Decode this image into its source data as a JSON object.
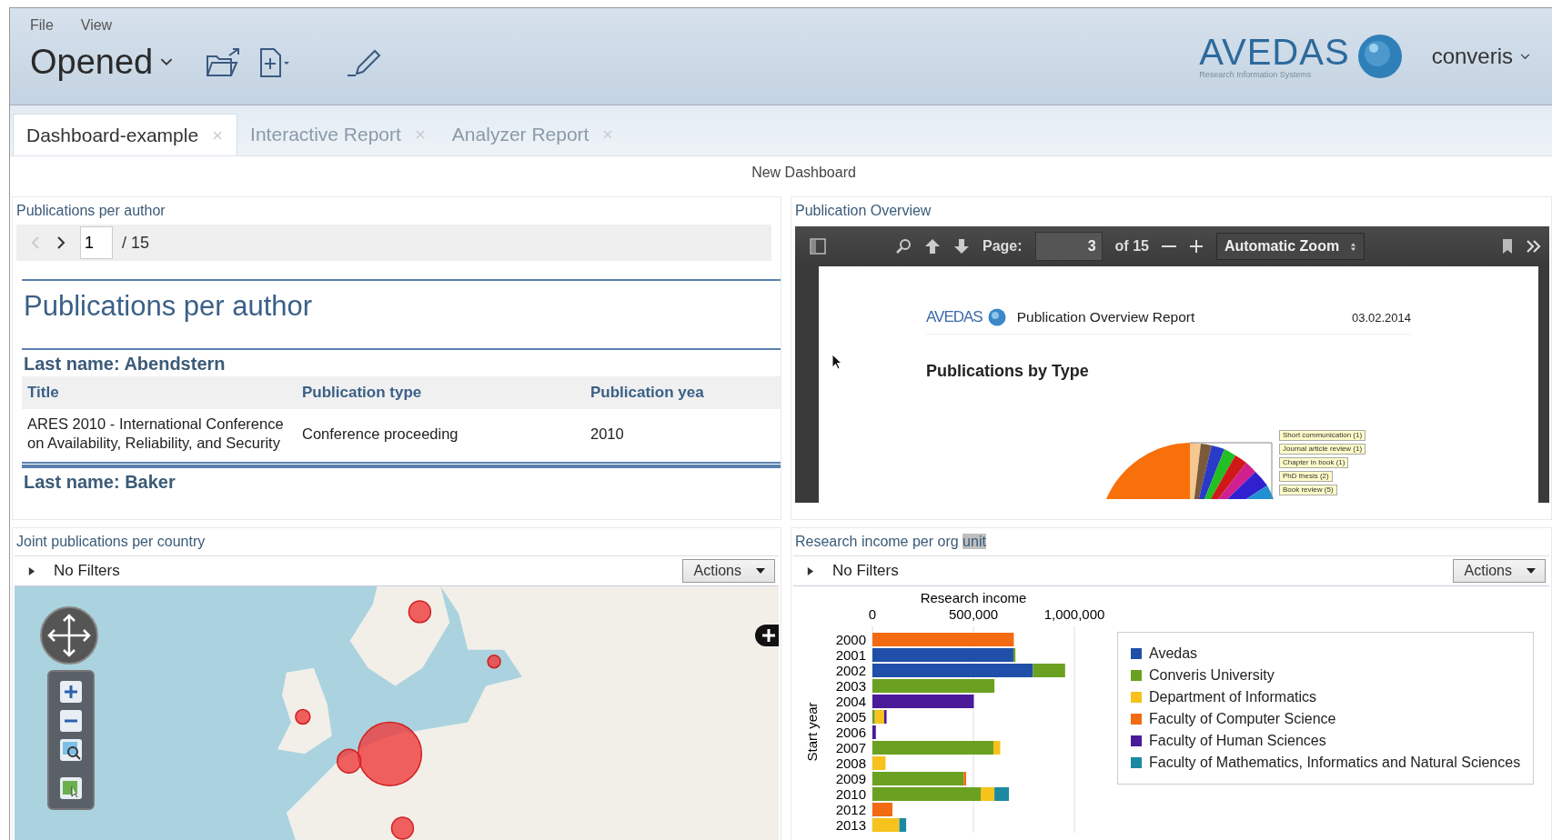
{
  "menu": [
    {
      "label": "File"
    },
    {
      "label": "View"
    }
  ],
  "header": {
    "view_selector": "Opened",
    "logo": {
      "name": "AVEDAS",
      "tagline": "Research Information Systems"
    },
    "user_menu": "converis"
  },
  "tabs": [
    {
      "label": "Dashboard-example",
      "selected": true
    },
    {
      "label": "Interactive Report",
      "selected": false
    },
    {
      "label": "Analyzer Report",
      "selected": false
    }
  ],
  "dashboard_title": "New Dashboard",
  "author_panel": {
    "title": "Publications per author",
    "pager": {
      "page": "1",
      "total": "/ 15",
      "prev_disabled": true
    },
    "report_title": "Publications per author",
    "groups": [
      {
        "heading": "Last name: Abendstern",
        "columns": [
          "Title",
          "Publication type",
          "Publication yea"
        ],
        "rows": [
          [
            "ARES 2010 - International Conference on Availability, Reliability, and Security",
            "Conference proceeding",
            "2010"
          ]
        ]
      },
      {
        "heading": "Last name: Baker"
      }
    ]
  },
  "pdf_panel": {
    "title": "Publication Overview",
    "page_label": "Page:",
    "page": "3",
    "page_count": "of 15",
    "zoom": "Automatic Zoom",
    "document": {
      "logo": "AVEDAS",
      "title": "Publication Overview Report",
      "date": "03.02.2014",
      "heading": "Publications by Type",
      "pie_labels": [
        "Short communication (1)",
        "Journal article review (1)",
        "Chapter in book (1)",
        "PhD thesis (2)",
        "Book review (5)"
      ]
    }
  },
  "map_panel": {
    "title": "Joint publications per country",
    "filter": {
      "label": "No Filters",
      "expanded": false
    },
    "actions": "Actions"
  },
  "income_panel": {
    "title_parts": [
      {
        "text": "Research income per org",
        "selected": false
      },
      {
        "text": "unit",
        "selected": true
      }
    ],
    "filter": {
      "label": "No Filters",
      "expanded": false
    },
    "actions": "Actions",
    "chart_data": {
      "type": "bar",
      "orientation": "horizontal",
      "stacked": true,
      "xlabel": "Research income",
      "ylabel": "Start year",
      "categories": [
        "2000",
        "2001",
        "2002",
        "2003",
        "2004",
        "2005",
        "2006",
        "2007",
        "2008",
        "2009",
        "2010",
        "2012",
        "2013"
      ],
      "xlim": [
        0,
        1000000
      ],
      "legend": true,
      "xticks": [
        {
          "value": 0,
          "label": "0"
        },
        {
          "value": 500000,
          "label": "500,000"
        },
        {
          "value": 1000000,
          "label": "1,000,000"
        }
      ],
      "series": [
        {
          "name": "Avedas",
          "color": "#1f4fa8",
          "values": [
            null,
            698000,
            795000,
            null,
            null,
            null,
            null,
            null,
            null,
            null,
            null,
            null,
            null
          ]
        },
        {
          "name": "Converis University",
          "color": "#6aa121",
          "values": [
            null,
            10000,
            159000,
            604000,
            null,
            12000,
            null,
            599000,
            null,
            452000,
            536000,
            null,
            null
          ]
        },
        {
          "name": "Department of Informatics",
          "color": "#f7c21b",
          "values": [
            null,
            null,
            null,
            null,
            null,
            46000,
            null,
            34000,
            65000,
            null,
            68000,
            null,
            133000
          ]
        },
        {
          "name": "Faculty of Computer Science",
          "color": "#f26b12",
          "values": [
            700000,
            null,
            null,
            null,
            null,
            null,
            null,
            null,
            null,
            12000,
            null,
            99000,
            null
          ]
        },
        {
          "name": "Faculty of Human Sciences",
          "color": "#4a1a9a",
          "values": [
            null,
            null,
            null,
            null,
            502000,
            12000,
            17000,
            null,
            null,
            null,
            null,
            null,
            null
          ]
        },
        {
          "name": "Faculty of Mathematics, Informatics and Natural Sciences",
          "color": "#1c8aa0",
          "values": [
            null,
            null,
            null,
            null,
            null,
            null,
            null,
            null,
            null,
            null,
            72000,
            null,
            34000
          ]
        }
      ]
    }
  }
}
